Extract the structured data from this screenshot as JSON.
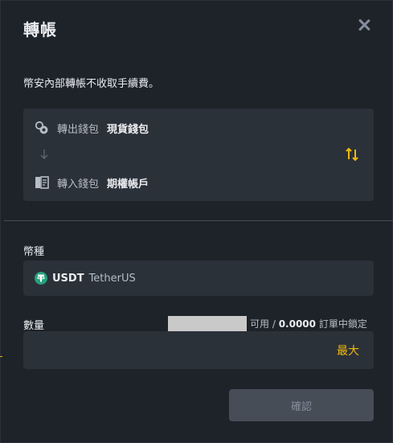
{
  "dialog": {
    "title": "轉帳",
    "notice": "幣安內部轉帳不收取手續費。"
  },
  "wallets": {
    "from_label": "轉出錢包",
    "from_value": "現貨錢包",
    "from_icon": "spot-wallet-icon",
    "to_label": "轉入錢包",
    "to_value": "期權帳戶",
    "to_icon": "options-account-icon",
    "swap_icon": "swap-icon"
  },
  "coin": {
    "label": "幣種",
    "symbol": "USDT",
    "name": "TetherUS",
    "icon": "tether-icon"
  },
  "amount": {
    "label": "數量",
    "available_prefix": "可用 /",
    "available_value": "0.0000",
    "available_suffix": "訂單中鎖定",
    "input_value": "",
    "max_label": "最大"
  },
  "actions": {
    "confirm_label": "確認"
  },
  "colors": {
    "background": "#1e2329",
    "surface": "#2b3139",
    "accent": "#f0b90b",
    "text": "#eaecef",
    "muted": "#b7bdc6",
    "disabled_button": "#474d57",
    "tether_green": "#26a17b"
  }
}
